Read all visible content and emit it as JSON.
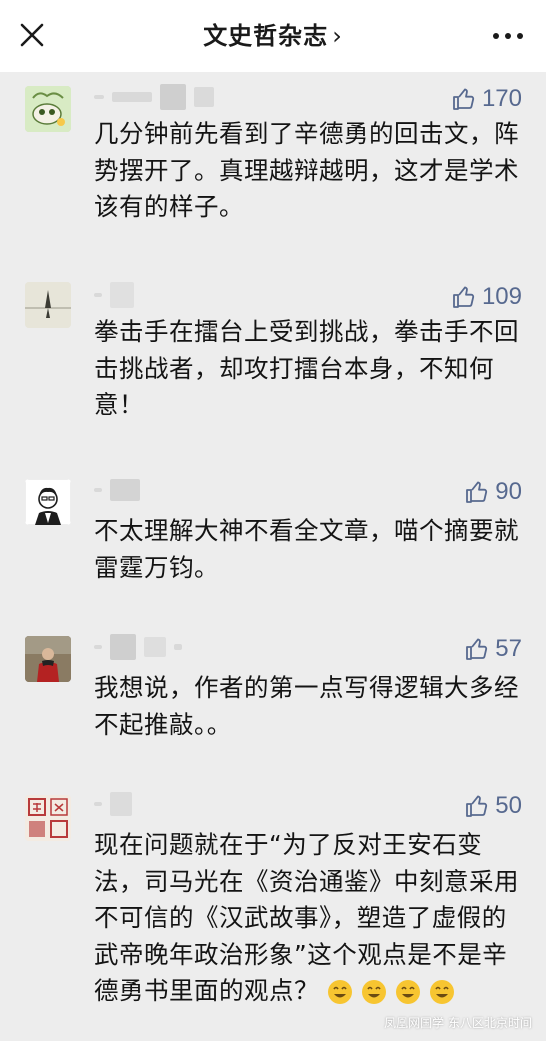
{
  "header": {
    "title": "文史哲杂志",
    "chevron": "›",
    "close_icon": "close-icon",
    "more_icon": "more-icon"
  },
  "colors": {
    "background": "#ededed",
    "like_color": "#57698f"
  },
  "comments": [
    {
      "likes": "170",
      "text": "几分钟前先看到了辛德勇的回击文，阵势摆开了。真理越辩越明，这才是学术该有的样子。"
    },
    {
      "likes": "109",
      "text": "拳击手在擂台上受到挑战，拳击手不回击挑战者，却攻打擂台本身，不知何意！"
    },
    {
      "likes": "90",
      "text": "不太理解大神不看全文章，喵个摘要就雷霆万钧。"
    },
    {
      "likes": "57",
      "text": "我想说，作者的第一点写得逻辑大多经不起推敲。。"
    },
    {
      "likes": "50",
      "text": "现在问题就在于“为了反对王安石变法，司马光在《资治通鉴》中刻意采用不可信的《汉武故事》，塑造了虚假的武帝晚年政治形象”这个观点是不是辛德勇书里面的观点？"
    }
  ],
  "watermark": "凤凰网国学 东八区北京时间"
}
